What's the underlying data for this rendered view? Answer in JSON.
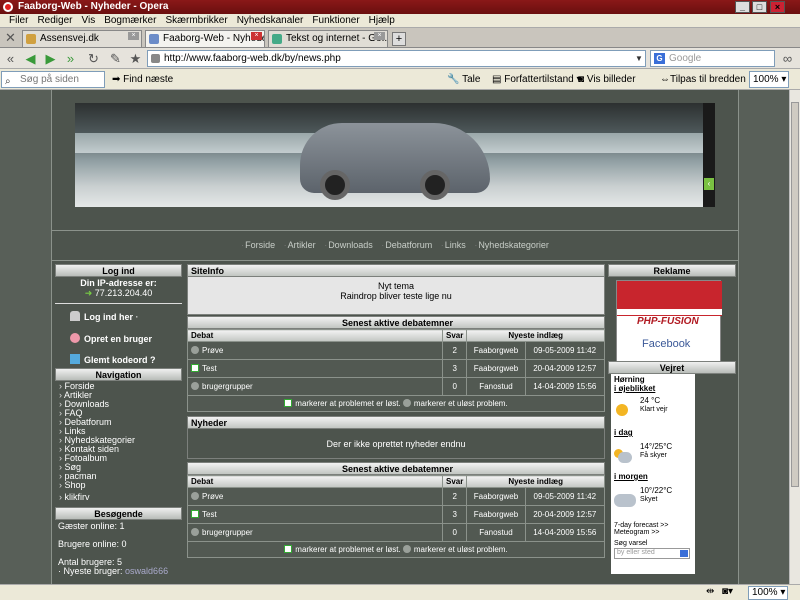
{
  "window": {
    "title": "Faaborg-Web - Nyheder - Opera"
  },
  "menu": [
    "Filer",
    "Rediger",
    "Vis",
    "Bogmærker",
    "Skærmbrikker",
    "Nyhedskanaler",
    "Funktioner",
    "Hjælp"
  ],
  "tabs": [
    {
      "label": "Assensvej.dk"
    },
    {
      "label": "Faaborg-Web - Nyheder"
    },
    {
      "label": "Tekst og internet - Go..."
    }
  ],
  "address": {
    "url": "http://www.faaborg-web.dk/by/news.php"
  },
  "search": {
    "placeholder": "Google"
  },
  "findbar": {
    "placeholder": "Søg på siden",
    "find_next": "Find næste",
    "speak": "Tale",
    "author_mode": "Forfattertilstand",
    "show_images": "Vis billeder",
    "fit_width": "Tilpas til bredden",
    "zoom": "100%"
  },
  "topnav": [
    "Forside",
    "Artikler",
    "Downloads",
    "Debatforum",
    "Links",
    "Nyhedskategorier"
  ],
  "login": {
    "title": "Log ind",
    "ip_label": "Din IP-adresse er:",
    "ip": "77.213.204.40",
    "login_here": "Log ind her",
    "create_user": "Opret en bruger",
    "forgot": "Glemt kodeord ?"
  },
  "navigation": {
    "title": "Navigation",
    "items": [
      "Forside",
      "Artikler",
      "Downloads",
      "FAQ",
      "Debatforum",
      "Links",
      "Nyhedskategorier",
      "Kontakt siden",
      "Fotoalbum",
      "Søg",
      "pacman",
      "Shop",
      "klikfirv"
    ]
  },
  "visitors": {
    "title": "Besøgende",
    "guests": "Gæster online: 1",
    "users": "Brugere online: 0",
    "count": "Antal brugere: 5",
    "newest_label": "Nyeste bruger:",
    "newest": "oswald666"
  },
  "siteinfo": {
    "title": "SiteInfo",
    "heading": "Nyt tema",
    "text": "Raindrop bliver teste lige nu"
  },
  "debate": {
    "title": "Senest aktive debatemner",
    "headers": [
      "Debat",
      "Svar",
      "Nyeste indlæg"
    ],
    "rows": [
      {
        "topic": "Prøve",
        "replies": "2",
        "user": "Faaborgweb",
        "date": "09-05-2009 11:42",
        "icon": "thread-icon"
      },
      {
        "topic": "Test",
        "replies": "3",
        "user": "Faaborgweb",
        "date": "20-04-2009 12:57",
        "icon": "solved-icon"
      },
      {
        "topic": "brugergrupper",
        "replies": "0",
        "user": "Fanostud",
        "date": "14-04-2009 15:56",
        "icon": "thread-icon"
      }
    ],
    "legend_solved": "markerer at problemet er løst.",
    "legend_unsolved": "markerer et uløst problem."
  },
  "news": {
    "title": "Nyheder",
    "empty": "Der er ikke oprettet nyheder endnu"
  },
  "ads": {
    "title": "Reklame",
    "logo": "PHP-FUSION",
    "brand": "Facebook"
  },
  "weather": {
    "title": "Vejret",
    "city": "Hørning",
    "now_label": "i øjeblikket",
    "now_temp": "24 °C",
    "now_desc": "Klart vejr",
    "today_label": "i dag",
    "today_temp": "14°/25°C",
    "today_desc": "Få skyer",
    "tomorrow_label": "i morgen",
    "tomorrow_temp": "10°/22°C",
    "tomorrow_desc": "Skyet",
    "forecast_link": "7-day forecast >>",
    "meteogram_link": "Meteogram >>",
    "search_label": "Søg varsel",
    "search_placeholder": "by eller sted"
  },
  "status": {
    "zoom": "100%"
  }
}
